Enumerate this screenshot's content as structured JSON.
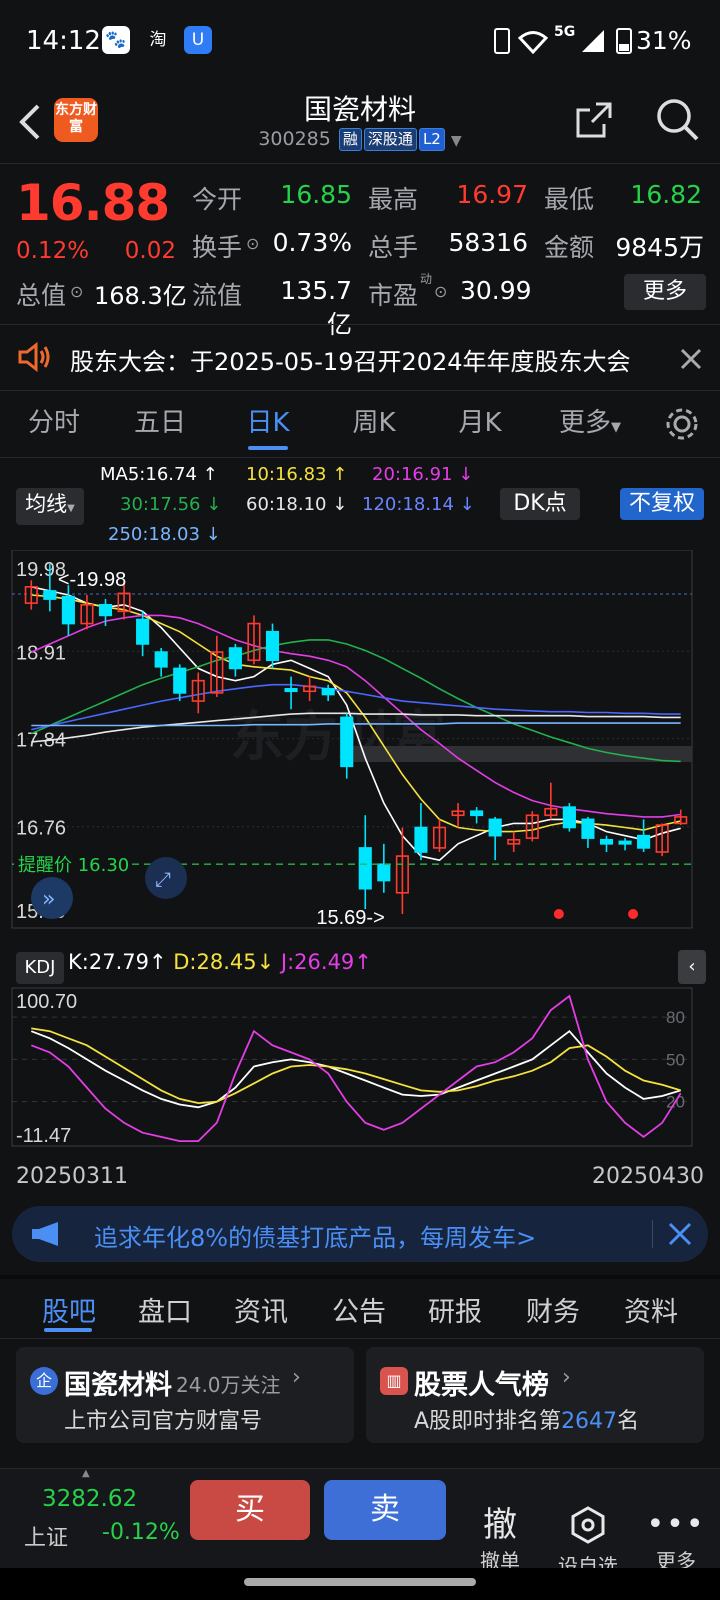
{
  "status_bar": {
    "time": "14:12",
    "network": "5G",
    "battery": "31%"
  },
  "header": {
    "title": "国瓷材料",
    "code": "300285",
    "tags": [
      "融",
      "深股通",
      "L2"
    ],
    "logo_text": "东方财富"
  },
  "quote": {
    "price": "16.88",
    "change_pct": "0.12%",
    "change": "0.02",
    "open_label": "今开",
    "open": "16.85",
    "high_label": "最高",
    "high": "16.97",
    "low_label": "最低",
    "low": "16.82",
    "turnover_label": "换手",
    "turnover": "0.73%",
    "volume_label": "总手",
    "volume": "58316",
    "amount_label": "金额",
    "amount": "9845万",
    "mcap_label": "总值",
    "mcap": "168.3亿",
    "float_label": "流值",
    "float": "135.7亿",
    "pe_label": "市盈",
    "pe_sup": "动",
    "pe": "30.99",
    "more": "更多"
  },
  "notice": {
    "text": "股东大会：于2025-05-19召开2024年年度股东大会"
  },
  "kline_tabs": [
    "分时",
    "五日",
    "日K",
    "周K",
    "月K",
    "更多"
  ],
  "kline_active": 2,
  "chart_controls": {
    "ma_button": "均线",
    "dk_button": "DK点",
    "adjust_button": "不复权"
  },
  "ma_legend": {
    "ma5": "MA5:16.74 ↑",
    "ma10": "10:16.83 ↑",
    "ma20": "20:16.91 ↓",
    "ma30": "30:17.56 ↓",
    "ma60": "60:18.10 ↓",
    "ma120": "120:18.14 ↓",
    "ma250": "250:18.03 ↓"
  },
  "colors": {
    "up": "#ff3b30",
    "down": "#00e5ff",
    "ma5": "#ffffff",
    "ma10": "#f5e23c",
    "ma20": "#e33ee6",
    "ma30": "#22b14c",
    "ma60": "#e8e8e8",
    "ma120": "#4a68ff",
    "ma250": "#78b4ff",
    "accent": "#4b8ff5"
  },
  "chart_data": [
    {
      "type": "candlestick",
      "x_start": "20250311",
      "x_end": "20250430",
      "y_tick_labels": [
        "19.98",
        "18.91",
        "17.84",
        "16.76",
        "15.69"
      ],
      "ylim": [
        15.69,
        19.98
      ],
      "high_marker": "<-19.98",
      "low_marker": "15.69->",
      "alert_line": {
        "label": "提醒价 16.30",
        "value": 16.3
      },
      "watermark": "东方财富",
      "candles": [
        [
          19.5,
          19.7,
          19.78,
          19.42
        ],
        [
          19.65,
          19.55,
          19.98,
          19.4
        ],
        [
          19.58,
          19.25,
          19.72,
          19.1
        ],
        [
          19.25,
          19.48,
          19.6,
          19.18
        ],
        [
          19.48,
          19.35,
          19.55,
          19.22
        ],
        [
          19.4,
          19.62,
          19.75,
          19.3
        ],
        [
          19.3,
          19.0,
          19.4,
          18.85
        ],
        [
          18.9,
          18.72,
          18.95,
          18.6
        ],
        [
          18.7,
          18.4,
          18.75,
          18.3
        ],
        [
          18.3,
          18.55,
          18.65,
          18.15
        ],
        [
          18.4,
          18.9,
          19.1,
          18.35
        ],
        [
          18.95,
          18.7,
          19.0,
          18.6
        ],
        [
          18.8,
          19.25,
          19.35,
          18.75
        ],
        [
          19.15,
          18.8,
          19.25,
          18.7
        ],
        [
          18.45,
          18.42,
          18.6,
          18.2
        ],
        [
          18.42,
          18.48,
          18.6,
          18.3
        ],
        [
          18.45,
          18.38,
          18.5,
          18.3
        ],
        [
          18.1,
          17.5,
          18.15,
          17.35
        ],
        [
          16.5,
          16.0,
          16.9,
          15.75
        ],
        [
          16.3,
          16.1,
          16.55,
          15.95
        ],
        [
          15.95,
          16.4,
          16.75,
          15.69
        ],
        [
          16.75,
          16.45,
          17.05,
          16.35
        ],
        [
          16.5,
          16.75,
          16.85,
          16.45
        ],
        [
          16.9,
          16.95,
          17.05,
          16.75
        ],
        [
          16.95,
          16.9,
          17.0,
          16.8
        ],
        [
          16.85,
          16.65,
          16.88,
          16.35
        ],
        [
          16.55,
          16.6,
          16.7,
          16.45
        ],
        [
          16.62,
          16.9,
          16.95,
          16.58
        ],
        [
          16.9,
          16.98,
          17.3,
          16.85
        ],
        [
          17.0,
          16.75,
          17.05,
          16.7
        ],
        [
          16.85,
          16.62,
          16.88,
          16.5
        ],
        [
          16.6,
          16.55,
          16.65,
          16.45
        ],
        [
          16.58,
          16.55,
          16.62,
          16.47
        ],
        [
          16.65,
          16.5,
          16.85,
          16.45
        ],
        [
          16.45,
          16.78,
          16.8,
          16.4
        ],
        [
          16.8,
          16.88,
          16.97,
          16.78
        ]
      ],
      "ma_series": [
        {
          "name": "MA5",
          "values": [
            19.7,
            19.65,
            19.6,
            19.5,
            19.45,
            19.48,
            19.4,
            19.2,
            18.95,
            18.7,
            18.6,
            18.55,
            18.6,
            18.75,
            18.8,
            18.7,
            18.6,
            18.25,
            17.6,
            17.05,
            16.65,
            16.4,
            16.35,
            16.55,
            16.65,
            16.75,
            16.8,
            16.8,
            16.85,
            16.85,
            16.8,
            16.7,
            16.65,
            16.6,
            16.68,
            16.74
          ]
        },
        {
          "name": "MA10",
          "values": [
            19.6,
            19.58,
            19.55,
            19.5,
            19.45,
            19.42,
            19.35,
            19.25,
            19.15,
            19.0,
            18.85,
            18.75,
            18.72,
            18.7,
            18.68,
            18.6,
            18.55,
            18.4,
            18.1,
            17.75,
            17.4,
            17.1,
            16.85,
            16.75,
            16.72,
            16.7,
            16.7,
            16.72,
            16.78,
            16.82,
            16.8,
            16.78,
            16.75,
            16.72,
            16.78,
            16.83
          ]
        },
        {
          "name": "MA20",
          "values": [
            18.9,
            19.0,
            19.1,
            19.2,
            19.28,
            19.32,
            19.35,
            19.35,
            19.32,
            19.25,
            19.15,
            19.05,
            18.98,
            18.92,
            18.88,
            18.85,
            18.8,
            18.72,
            18.55,
            18.35,
            18.15,
            17.95,
            17.78,
            17.6,
            17.45,
            17.3,
            17.18,
            17.08,
            17.02,
            16.98,
            16.95,
            16.92,
            16.9,
            16.88,
            16.88,
            16.91
          ]
        },
        {
          "name": "MA30",
          "values": [
            17.9,
            18.0,
            18.1,
            18.2,
            18.3,
            18.4,
            18.5,
            18.58,
            18.65,
            18.72,
            18.8,
            18.85,
            18.92,
            18.98,
            19.02,
            19.05,
            19.05,
            19.0,
            18.92,
            18.82,
            18.7,
            18.58,
            18.45,
            18.33,
            18.22,
            18.12,
            18.02,
            17.94,
            17.86,
            17.79,
            17.72,
            17.67,
            17.63,
            17.6,
            17.57,
            17.56
          ]
        },
        {
          "name": "MA60",
          "values": [
            17.8,
            17.82,
            17.85,
            17.88,
            17.92,
            17.95,
            17.98,
            18.0,
            18.02,
            18.04,
            18.06,
            18.08,
            18.1,
            18.12,
            18.14,
            18.15,
            18.15,
            18.15,
            18.14,
            18.14,
            18.14,
            18.13,
            18.13,
            18.13,
            18.12,
            18.12,
            18.12,
            18.12,
            18.12,
            18.12,
            18.11,
            18.11,
            18.11,
            18.11,
            18.1,
            18.1
          ]
        },
        {
          "name": "MA120",
          "values": [
            17.95,
            18.0,
            18.05,
            18.1,
            18.15,
            18.2,
            18.25,
            18.3,
            18.34,
            18.38,
            18.42,
            18.45,
            18.48,
            18.5,
            18.5,
            18.48,
            18.45,
            18.42,
            18.38,
            18.34,
            18.3,
            18.28,
            18.26,
            18.24,
            18.22,
            18.2,
            18.19,
            18.18,
            18.17,
            18.17,
            18.16,
            18.16,
            18.15,
            18.15,
            18.14,
            18.14
          ]
        },
        {
          "name": "MA250",
          "values": [
            18.0,
            18.0,
            18.0,
            18.0,
            18.0,
            18.0,
            18.0,
            18.0,
            18.0,
            18.0,
            18.0,
            18.0,
            18.01,
            18.01,
            18.01,
            18.01,
            18.02,
            18.02,
            18.02,
            18.02,
            18.02,
            18.02,
            18.02,
            18.03,
            18.03,
            18.03,
            18.03,
            18.03,
            18.03,
            18.03,
            18.03,
            18.03,
            18.03,
            18.03,
            18.03,
            18.03
          ]
        }
      ],
      "signal_dots_index": [
        28,
        32
      ]
    },
    {
      "type": "line",
      "indicator": "KDJ",
      "y_tick_labels": [
        "100.70",
        "-11.47"
      ],
      "right_ticks": [
        "80",
        "50",
        "20"
      ],
      "ylim": [
        -11.47,
        100.7
      ],
      "legend": {
        "k": "K:27.79↑",
        "d": "D:28.45↓",
        "j": "J:26.49↑"
      },
      "series": [
        {
          "name": "K",
          "values": [
            70,
            65,
            58,
            50,
            42,
            35,
            28,
            22,
            18,
            16,
            20,
            30,
            45,
            48,
            50,
            48,
            45,
            40,
            35,
            30,
            25,
            24,
            25,
            30,
            35,
            40,
            45,
            50,
            60,
            70,
            55,
            40,
            30,
            22,
            24,
            28
          ]
        },
        {
          "name": "D",
          "values": [
            72,
            70,
            65,
            60,
            52,
            44,
            36,
            28,
            22,
            19,
            20,
            26,
            33,
            40,
            45,
            46,
            45,
            43,
            40,
            36,
            32,
            28,
            27,
            28,
            31,
            35,
            38,
            42,
            48,
            58,
            60,
            52,
            42,
            35,
            32,
            28
          ]
        },
        {
          "name": "J",
          "values": [
            60,
            55,
            45,
            30,
            15,
            5,
            -2,
            -5,
            -8,
            -8,
            5,
            40,
            70,
            60,
            55,
            50,
            40,
            20,
            5,
            0,
            5,
            15,
            25,
            35,
            45,
            48,
            55,
            65,
            85,
            95,
            50,
            20,
            5,
            -5,
            5,
            26
          ]
        }
      ]
    }
  ],
  "chart_range": {
    "start": "20250311",
    "end": "20250430"
  },
  "ad_banner": {
    "text": "追求年化8%的债基打底产品，每周发车>"
  },
  "bottom_tabs": [
    "股吧",
    "盘口",
    "资讯",
    "公告",
    "研报",
    "财务",
    "资料"
  ],
  "cards": {
    "left": {
      "title": "国瓷材料",
      "followers": "24.0万关注",
      "subtitle": "上市公司官方财富号"
    },
    "right": {
      "title": "股票人气榜",
      "subtitle_pre": "A股即时排名第",
      "rank": "2647",
      "subtitle_post": "名"
    }
  },
  "footer": {
    "index_value": "3282.62",
    "index_name": "上证",
    "index_change": "-0.12%",
    "buy": "买",
    "sell": "卖",
    "cancel_icon": "撤",
    "cancel_label": "撤单",
    "add_label": "设自选",
    "more_label": "更多"
  }
}
